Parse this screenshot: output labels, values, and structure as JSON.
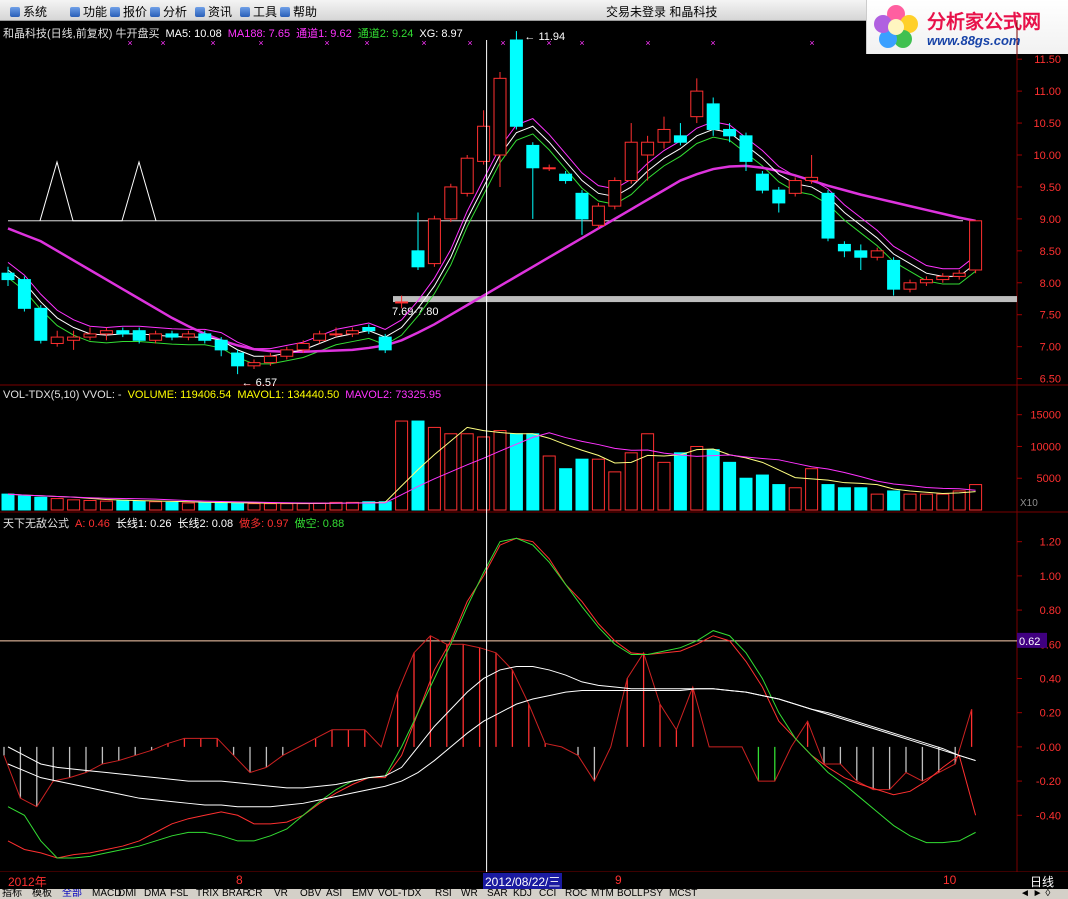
{
  "menu": [
    "系统",
    "功能",
    "报价",
    "分析",
    "资讯",
    "工具",
    "帮助"
  ],
  "status": {
    "login": "交易未登录",
    "stock": "和晶科技"
  },
  "logo": {
    "title": "分析家公式网",
    "url": "www.88gs.com"
  },
  "main_header": {
    "title": "和晶科技(日线,前复权) 牛开盘买",
    "items": [
      {
        "label": "MA5: 10.08",
        "color": "#ffffff"
      },
      {
        "label": "MA188: 7.65",
        "color": "#ff33ff"
      },
      {
        "label": "通道1: 9.62",
        "color": "#ff33ff"
      },
      {
        "label": "通道2: 9.24",
        "color": "#33dd33"
      },
      {
        "label": "XG: 8.97",
        "color": "#ffffff"
      }
    ]
  },
  "vol_header": {
    "title": "VOL-TDX(5,10) VVOL: -",
    "items": [
      {
        "label": "VOLUME: 119406.54",
        "color": "#ffff00"
      },
      {
        "label": "MAVOL1: 134440.50",
        "color": "#ffff00"
      },
      {
        "label": "MAVOL2: 73325.95",
        "color": "#ff33ff"
      }
    ]
  },
  "ind_header": {
    "title": "天下无敌公式",
    "items": [
      {
        "label": "A: 0.46",
        "color": "#ff3030"
      },
      {
        "label": "长线1: 0.26",
        "color": "#ffffff"
      },
      {
        "label": "长线2: 0.08",
        "color": "#ffffff"
      },
      {
        "label": "做多: 0.97",
        "color": "#ff3030"
      },
      {
        "label": "做空: 0.88",
        "color": "#33dd33"
      }
    ]
  },
  "price_axis": [
    "11.50",
    "11.00",
    "10.50",
    "10.00",
    "9.50",
    "9.00",
    "8.50",
    "8.00",
    "7.50",
    "7.00",
    "6.50"
  ],
  "vol_axis": [
    "15000",
    "10000",
    "5000"
  ],
  "vol_unit": "X10",
  "ind_axis": [
    "1.20",
    "1.00",
    "0.80",
    "0.60",
    "0.40",
    "0.20",
    "-0.00",
    "-0.20",
    "-0.40"
  ],
  "ind_marker": "0.62",
  "annotations": {
    "high": "11.94",
    "low": "6.57",
    "band": "7.69-7.80"
  },
  "date_bar": {
    "left": "2012年",
    "m8": "8",
    "cursor": "2012/08/22/三",
    "m9": "9",
    "m10": "10",
    "period": "日线"
  },
  "tabs": [
    "指标",
    "模板",
    "全部",
    "MACD",
    "DMI",
    "DMA",
    "FSL",
    "TRIX",
    "BRAR",
    "CR",
    "VR",
    "OBV",
    "ASI",
    "EMV",
    "VOL-TDX",
    "RSI",
    "WR",
    "SAR",
    "KDJ",
    "CCI",
    "ROC",
    "MTM",
    "BOLL",
    "PSY",
    "MCST"
  ],
  "colors": {
    "up": "#ff3030",
    "down": "#00ffff",
    "ma_white": "#ffffff",
    "ma_pink": "#ff33ff",
    "ma_green": "#33dd33",
    "ma188": "#dd33dd",
    "grid": "#7a0000"
  },
  "chart_data": [
    {
      "type": "candlestick",
      "title": "和晶科技(日线,前复权) 牛开盘买",
      "ylim": [
        6.4,
        11.8
      ],
      "candles": [
        {
          "o": 8.15,
          "c": 8.05,
          "h": 8.25,
          "l": 7.95
        },
        {
          "o": 8.05,
          "c": 7.6,
          "h": 8.1,
          "l": 7.55
        },
        {
          "o": 7.6,
          "c": 7.1,
          "h": 7.65,
          "l": 7.05
        },
        {
          "o": 7.05,
          "c": 7.15,
          "h": 7.25,
          "l": 7.0
        },
        {
          "o": 7.1,
          "c": 7.15,
          "h": 7.25,
          "l": 6.95
        },
        {
          "o": 7.15,
          "c": 7.2,
          "h": 7.3,
          "l": 7.1
        },
        {
          "o": 7.2,
          "c": 7.25,
          "h": 7.3,
          "l": 7.1
        },
        {
          "o": 7.25,
          "c": 7.2,
          "h": 7.3,
          "l": 7.15
        },
        {
          "o": 7.25,
          "c": 7.1,
          "h": 7.3,
          "l": 7.05
        },
        {
          "o": 7.1,
          "c": 7.2,
          "h": 7.25,
          "l": 7.05
        },
        {
          "o": 7.2,
          "c": 7.15,
          "h": 7.25,
          "l": 7.1
        },
        {
          "o": 7.15,
          "c": 7.2,
          "h": 7.25,
          "l": 7.1
        },
        {
          "o": 7.2,
          "c": 7.1,
          "h": 7.25,
          "l": 7.05
        },
        {
          "o": 7.1,
          "c": 6.95,
          "h": 7.15,
          "l": 6.85
        },
        {
          "o": 6.9,
          "c": 6.7,
          "h": 6.95,
          "l": 6.57
        },
        {
          "o": 6.7,
          "c": 6.75,
          "h": 6.8,
          "l": 6.65
        },
        {
          "o": 6.75,
          "c": 6.85,
          "h": 6.9,
          "l": 6.7
        },
        {
          "o": 6.85,
          "c": 6.95,
          "h": 7.0,
          "l": 6.8
        },
        {
          "o": 6.95,
          "c": 7.05,
          "h": 7.1,
          "l": 6.9
        },
        {
          "o": 7.1,
          "c": 7.2,
          "h": 7.25,
          "l": 7.05
        },
        {
          "o": 7.2,
          "c": 7.2,
          "h": 7.3,
          "l": 7.15
        },
        {
          "o": 7.2,
          "c": 7.25,
          "h": 7.3,
          "l": 7.15
        },
        {
          "o": 7.3,
          "c": 7.25,
          "h": 7.35,
          "l": 7.2
        },
        {
          "o": 7.15,
          "c": 6.95,
          "h": 7.2,
          "l": 6.9
        },
        {
          "o": 7.7,
          "c": 7.7,
          "h": 7.8,
          "l": 7.6
        },
        {
          "o": 8.5,
          "c": 8.25,
          "h": 9.1,
          "l": 8.2
        },
        {
          "o": 8.3,
          "c": 9.0,
          "h": 9.05,
          "l": 8.25
        },
        {
          "o": 9.0,
          "c": 9.5,
          "h": 9.55,
          "l": 8.95
        },
        {
          "o": 9.4,
          "c": 9.95,
          "h": 10.0,
          "l": 9.35
        },
        {
          "o": 9.9,
          "c": 10.45,
          "h": 10.7,
          "l": 9.85
        },
        {
          "o": 10.0,
          "c": 11.2,
          "h": 11.3,
          "l": 9.5
        },
        {
          "o": 11.8,
          "c": 10.45,
          "h": 11.94,
          "l": 10.4
        },
        {
          "o": 10.15,
          "c": 9.8,
          "h": 10.2,
          "l": 9.0
        },
        {
          "o": 9.8,
          "c": 9.8,
          "h": 9.85,
          "l": 9.75
        },
        {
          "o": 9.7,
          "c": 9.6,
          "h": 9.75,
          "l": 9.55
        },
        {
          "o": 9.4,
          "c": 9.0,
          "h": 9.45,
          "l": 8.75
        },
        {
          "o": 8.9,
          "c": 9.2,
          "h": 9.25,
          "l": 8.85
        },
        {
          "o": 9.2,
          "c": 9.6,
          "h": 9.65,
          "l": 9.15
        },
        {
          "o": 9.6,
          "c": 10.2,
          "h": 10.5,
          "l": 9.55
        },
        {
          "o": 10.0,
          "c": 10.2,
          "h": 10.3,
          "l": 9.6
        },
        {
          "o": 10.2,
          "c": 10.4,
          "h": 10.6,
          "l": 10.1
        },
        {
          "o": 10.3,
          "c": 10.2,
          "h": 10.5,
          "l": 10.15
        },
        {
          "o": 10.6,
          "c": 11.0,
          "h": 11.2,
          "l": 10.5
        },
        {
          "o": 10.8,
          "c": 10.4,
          "h": 10.9,
          "l": 10.3
        },
        {
          "o": 10.4,
          "c": 10.3,
          "h": 10.5,
          "l": 10.2
        },
        {
          "o": 10.3,
          "c": 9.9,
          "h": 10.35,
          "l": 9.75
        },
        {
          "o": 9.7,
          "c": 9.45,
          "h": 9.75,
          "l": 9.4
        },
        {
          "o": 9.45,
          "c": 9.25,
          "h": 9.5,
          "l": 9.1
        },
        {
          "o": 9.4,
          "c": 9.6,
          "h": 9.65,
          "l": 9.35
        },
        {
          "o": 9.6,
          "c": 9.65,
          "h": 10.0,
          "l": 9.55
        },
        {
          "o": 9.4,
          "c": 8.7,
          "h": 9.45,
          "l": 8.65
        },
        {
          "o": 8.6,
          "c": 8.5,
          "h": 8.65,
          "l": 8.4
        },
        {
          "o": 8.5,
          "c": 8.4,
          "h": 8.6,
          "l": 8.2
        },
        {
          "o": 8.4,
          "c": 8.5,
          "h": 8.55,
          "l": 8.35
        },
        {
          "o": 8.35,
          "c": 7.9,
          "h": 8.4,
          "l": 7.8
        },
        {
          "o": 7.9,
          "c": 8.0,
          "h": 8.05,
          "l": 7.85
        },
        {
          "o": 8.0,
          "c": 8.05,
          "h": 8.1,
          "l": 7.95
        },
        {
          "o": 8.05,
          "c": 8.1,
          "h": 8.15,
          "l": 8.0
        },
        {
          "o": 8.1,
          "c": 8.15,
          "h": 8.2,
          "l": 8.05
        },
        {
          "o": 8.2,
          "c": 8.97,
          "h": 8.97,
          "l": 8.15
        }
      ],
      "ma5": [
        8.2,
        8.0,
        7.7,
        7.45,
        7.3,
        7.2,
        7.18,
        7.2,
        7.2,
        7.18,
        7.16,
        7.15,
        7.15,
        7.1,
        6.95,
        6.85,
        6.85,
        6.9,
        6.95,
        7.05,
        7.15,
        7.2,
        7.25,
        7.15,
        7.3,
        7.6,
        7.95,
        8.4,
        9.0,
        9.5,
        10.0,
        10.35,
        10.45,
        10.2,
        9.9,
        9.6,
        9.4,
        9.35,
        9.5,
        9.75,
        9.95,
        10.1,
        10.3,
        10.4,
        10.35,
        10.15,
        9.95,
        9.7,
        9.55,
        9.5,
        9.35,
        9.1,
        8.9,
        8.7,
        8.45,
        8.3,
        8.15,
        8.1,
        8.1,
        8.3
      ],
      "ma188": [
        8.85,
        8.75,
        8.65,
        8.5,
        8.35,
        8.2,
        8.05,
        7.9,
        7.75,
        7.6,
        7.45,
        7.32,
        7.2,
        7.1,
        7.02,
        6.96,
        6.93,
        6.92,
        6.92,
        6.93,
        6.94,
        6.95,
        6.98,
        7.02,
        7.1,
        7.22,
        7.35,
        7.5,
        7.65,
        7.8,
        7.95,
        8.1,
        8.25,
        8.4,
        8.55,
        8.7,
        8.85,
        9.0,
        9.15,
        9.3,
        9.45,
        9.6,
        9.7,
        9.78,
        9.82,
        9.83,
        9.8,
        9.75,
        9.68,
        9.6,
        9.52,
        9.45,
        9.38,
        9.32,
        9.26,
        9.2,
        9.14,
        9.08,
        9.02,
        8.97
      ]
    },
    {
      "type": "bar",
      "title": "VOL-TDX(5,10)",
      "ylim": [
        0,
        17000
      ],
      "values": [
        2500,
        2200,
        2000,
        1800,
        1600,
        1500,
        1400,
        1500,
        1400,
        1300,
        1200,
        1100,
        1100,
        1200,
        1100,
        1000,
        1000,
        1000,
        1000,
        1100,
        1200,
        1200,
        1300,
        1300,
        14000,
        14000,
        13000,
        12000,
        12000,
        11500,
        12500,
        12000,
        12000,
        8500,
        6500,
        8000,
        8000,
        6000,
        9000,
        12000,
        7500,
        9000,
        10000,
        9500,
        7500,
        5000,
        5500,
        4000,
        3500,
        6500,
        4000,
        3500,
        3500,
        2500,
        3000,
        2500,
        2500,
        2500,
        3000,
        4000
      ]
    },
    {
      "type": "line",
      "title": "天下无敌公式",
      "ylim": [
        -0.72,
        1.28
      ],
      "series": [
        {
          "name": "A",
          "values": [
            -0.05,
            -0.3,
            -0.35,
            -0.2,
            -0.18,
            -0.15,
            -0.1,
            -0.08,
            -0.05,
            -0.02,
            0.02,
            0.05,
            0.05,
            0.05,
            -0.05,
            -0.15,
            -0.12,
            -0.05,
            0.0,
            0.05,
            0.1,
            0.1,
            0.1,
            0.0,
            0.32,
            0.55,
            0.65,
            0.6,
            0.6,
            0.58,
            0.55,
            0.45,
            0.25,
            0.02,
            0.0,
            -0.05,
            -0.2,
            0.0,
            0.4,
            0.55,
            0.25,
            0.1,
            0.35,
            0.0,
            0.0,
            0.0,
            -0.2,
            -0.2,
            0.0,
            0.15,
            -0.1,
            -0.1,
            -0.2,
            -0.25,
            -0.25,
            -0.15,
            -0.2,
            -0.15,
            -0.1,
            0.22
          ]
        },
        {
          "name": "做多",
          "values": [
            -0.55,
            -0.6,
            -0.62,
            -0.65,
            -0.63,
            -0.62,
            -0.6,
            -0.58,
            -0.55,
            -0.5,
            -0.45,
            -0.42,
            -0.4,
            -0.38,
            -0.4,
            -0.45,
            -0.45,
            -0.44,
            -0.4,
            -0.33,
            -0.27,
            -0.22,
            -0.18,
            -0.18,
            -0.05,
            0.2,
            0.45,
            0.62,
            0.85,
            1.0,
            1.18,
            1.22,
            1.2,
            1.1,
            0.95,
            0.85,
            0.72,
            0.62,
            0.55,
            0.54,
            0.55,
            0.56,
            0.6,
            0.65,
            0.62,
            0.5,
            0.35,
            0.15,
            0.05,
            -0.05,
            -0.12,
            -0.18,
            -0.22,
            -0.25,
            -0.28,
            -0.26,
            -0.2,
            -0.12,
            -0.05,
            -0.4
          ]
        },
        {
          "name": "做空",
          "values": [
            -0.35,
            -0.4,
            -0.55,
            -0.65,
            -0.65,
            -0.64,
            -0.62,
            -0.6,
            -0.58,
            -0.55,
            -0.52,
            -0.5,
            -0.5,
            -0.52,
            -0.55,
            -0.55,
            -0.52,
            -0.48,
            -0.4,
            -0.32,
            -0.25,
            -0.2,
            -0.18,
            -0.17,
            0.0,
            0.2,
            0.4,
            0.6,
            0.82,
            1.02,
            1.2,
            1.22,
            1.18,
            1.08,
            0.95,
            0.82,
            0.7,
            0.6,
            0.54,
            0.54,
            0.56,
            0.58,
            0.62,
            0.68,
            0.65,
            0.55,
            0.4,
            0.2,
            0.05,
            -0.05,
            -0.15,
            -0.22,
            -0.3,
            -0.38,
            -0.46,
            -0.52,
            -0.56,
            -0.56,
            -0.55,
            -0.5
          ]
        },
        {
          "name": "长线1",
          "values": [
            0.0,
            -0.05,
            -0.1,
            -0.12,
            -0.13,
            -0.14,
            -0.15,
            -0.16,
            -0.17,
            -0.18,
            -0.19,
            -0.2,
            -0.2,
            -0.2,
            -0.21,
            -0.22,
            -0.23,
            -0.24,
            -0.24,
            -0.23,
            -0.22,
            -0.2,
            -0.18,
            -0.17,
            -0.12,
            0.0,
            0.12,
            0.22,
            0.32,
            0.4,
            0.45,
            0.47,
            0.47,
            0.45,
            0.42,
            0.38,
            0.36,
            0.35,
            0.34,
            0.34,
            0.34,
            0.34,
            0.34,
            0.34,
            0.33,
            0.32,
            0.3,
            0.28,
            0.25,
            0.22,
            0.2,
            0.17,
            0.14,
            0.11,
            0.08,
            0.05,
            0.02,
            -0.01,
            -0.05,
            -0.08
          ]
        },
        {
          "name": "长线2",
          "values": [
            -0.1,
            -0.14,
            -0.18,
            -0.2,
            -0.22,
            -0.24,
            -0.26,
            -0.28,
            -0.3,
            -0.31,
            -0.32,
            -0.33,
            -0.34,
            -0.34,
            -0.35,
            -0.35,
            -0.35,
            -0.34,
            -0.33,
            -0.31,
            -0.29,
            -0.27,
            -0.25,
            -0.23,
            -0.2,
            -0.15,
            -0.08,
            0.0,
            0.08,
            0.15,
            0.2,
            0.25,
            0.28,
            0.3,
            0.32,
            0.33,
            0.33,
            0.33,
            0.33,
            0.33,
            0.33,
            0.33,
            0.34,
            0.34,
            0.33,
            0.32,
            0.3,
            0.28,
            0.25,
            0.22,
            0.19,
            0.16,
            0.13,
            0.1,
            0.07,
            0.04,
            0.01,
            -0.02,
            -0.05,
            -0.08
          ]
        }
      ]
    }
  ]
}
